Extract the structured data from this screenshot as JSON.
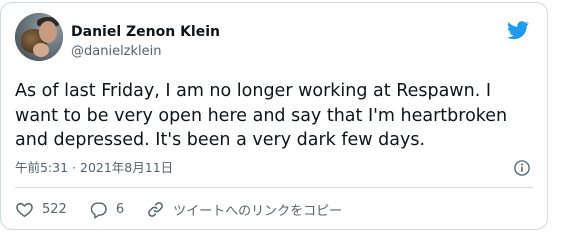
{
  "author": {
    "name": "Daniel Zenon Klein",
    "handle": "@danielzklein"
  },
  "tweet": {
    "lines": [
      "As of last Friday, I am no longer working at Respawn. I",
      "want to be very open here and say that I'm heartbroken",
      "and depressed. It's been a very dark few days."
    ],
    "timestamp": "午前5:31 · 2021年8月11日"
  },
  "actions": {
    "likes": "522",
    "replies": "6",
    "copy_link_label": "ツイートへのリンクをコピー"
  },
  "colors": {
    "twitter_blue": "#1d9bf0",
    "secondary_text": "#536471",
    "border": "#cfd9de"
  },
  "icons": {
    "brand": "twitter-bird-icon",
    "info": "info-icon",
    "like": "heart-icon",
    "reply": "comment-icon",
    "copy_link": "link-icon"
  }
}
